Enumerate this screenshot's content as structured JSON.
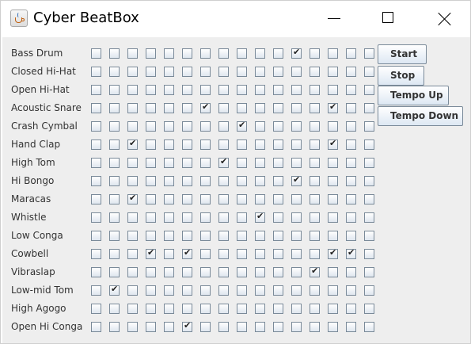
{
  "window": {
    "title": "Cyber BeatBox"
  },
  "instruments": [
    {
      "name": "Bass Drum",
      "checked": [
        11
      ]
    },
    {
      "name": "Closed Hi-Hat",
      "checked": []
    },
    {
      "name": "Open Hi-Hat",
      "checked": []
    },
    {
      "name": "Acoustic Snare",
      "checked": [
        6,
        13
      ]
    },
    {
      "name": "Crash Cymbal",
      "checked": [
        8
      ]
    },
    {
      "name": "Hand Clap",
      "checked": [
        2,
        13
      ]
    },
    {
      "name": "High Tom",
      "checked": [
        7
      ]
    },
    {
      "name": "Hi Bongo",
      "checked": [
        11
      ]
    },
    {
      "name": "Maracas",
      "checked": [
        2
      ]
    },
    {
      "name": "Whistle",
      "checked": [
        9
      ]
    },
    {
      "name": "Low Conga",
      "checked": []
    },
    {
      "name": "Cowbell",
      "checked": [
        3,
        5,
        13,
        14
      ]
    },
    {
      "name": "Vibraslap",
      "checked": [
        12
      ]
    },
    {
      "name": "Low-mid Tom",
      "checked": [
        1
      ]
    },
    {
      "name": "High Agogo",
      "checked": []
    },
    {
      "name": "Open Hi Conga",
      "checked": [
        5
      ]
    }
  ],
  "steps": 16,
  "buttons": {
    "start": "Start",
    "stop": "Stop",
    "tempo_up": "Tempo Up",
    "tempo_down": "Tempo Down"
  }
}
